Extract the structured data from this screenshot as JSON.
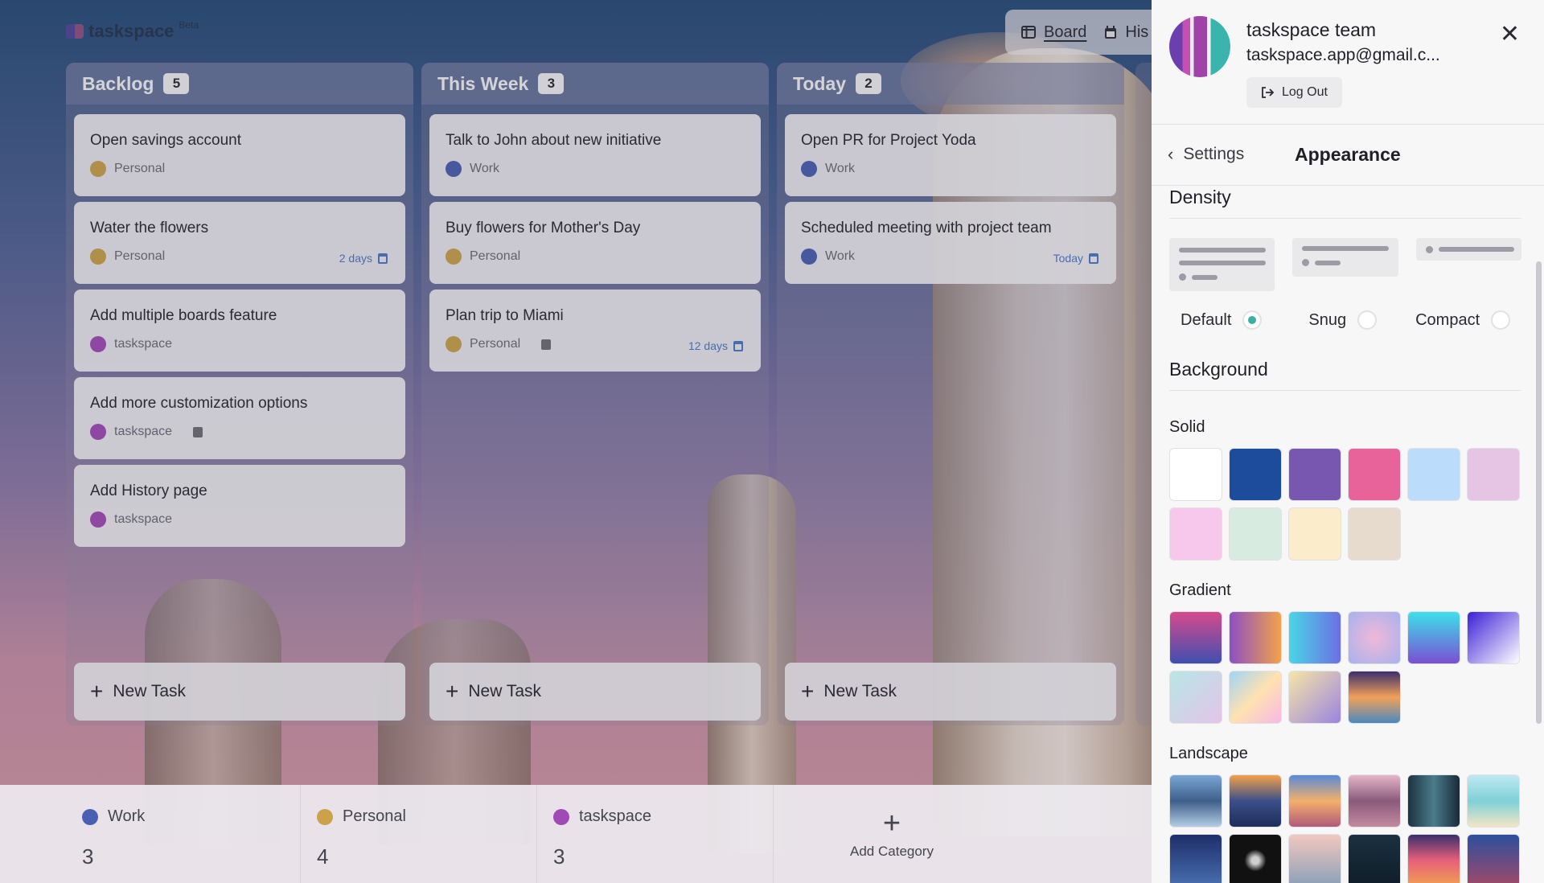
{
  "app": {
    "name": "taskspace",
    "badge": "Beta"
  },
  "view_tabs": [
    {
      "label": "Board",
      "icon": "board-icon",
      "active": true
    },
    {
      "label": "His",
      "icon": "calendar-icon",
      "active": false
    }
  ],
  "columns": [
    {
      "title": "Backlog",
      "count": "5",
      "cards": [
        {
          "title": "Open savings account",
          "category": "Personal",
          "color": "#c9a24a"
        },
        {
          "title": "Water the flowers",
          "category": "Personal",
          "color": "#c9a24a",
          "due": "2 days"
        },
        {
          "title": "Add multiple boards feature",
          "category": "taskspace",
          "color": "#a04ab8"
        },
        {
          "title": "Add more customization options",
          "category": "taskspace",
          "color": "#a04ab8",
          "note": true
        },
        {
          "title": "Add History page",
          "category": "taskspace",
          "color": "#a04ab8"
        }
      ],
      "new_task": "New Task"
    },
    {
      "title": "This Week",
      "count": "3",
      "cards": [
        {
          "title": "Talk to John about new initiative",
          "category": "Work",
          "color": "#4a5eb3"
        },
        {
          "title": "Buy flowers for Mother's Day",
          "category": "Personal",
          "color": "#c9a24a"
        },
        {
          "title": "Plan trip to Miami",
          "category": "Personal",
          "color": "#c9a24a",
          "note": true,
          "due": "12 days"
        }
      ],
      "new_task": "New Task"
    },
    {
      "title": "Today",
      "count": "2",
      "cards": [
        {
          "title": "Open PR for Project Yoda",
          "category": "Work",
          "color": "#4a5eb3"
        },
        {
          "title": "Scheduled meeting with project team",
          "category": "Work",
          "color": "#4a5eb3",
          "due": "Today"
        }
      ],
      "new_task": "New Task"
    }
  ],
  "categories": [
    {
      "name": "Work",
      "count": "3",
      "color": "#4a5eb3"
    },
    {
      "name": "Personal",
      "count": "4",
      "color": "#c9a24a"
    },
    {
      "name": "taskspace",
      "count": "3",
      "color": "#a04ab8"
    }
  ],
  "add_category": "Add Category",
  "account": {
    "name": "taskspace team",
    "email": "taskspace.app@gmail.c...",
    "logout": "Log Out"
  },
  "settings": {
    "back": "Settings",
    "title": "Appearance",
    "density": {
      "heading": "Density",
      "options": [
        {
          "label": "Default",
          "selected": true
        },
        {
          "label": "Snug",
          "selected": false
        },
        {
          "label": "Compact",
          "selected": false
        }
      ]
    },
    "background": {
      "heading": "Background",
      "solid": {
        "label": "Solid",
        "colors": [
          "#ffffff",
          "#1e4c9c",
          "#7857b0",
          "#e8639a",
          "#bcdcfb",
          "#e6c4e4",
          "#f8c8ec",
          "#d7ebe1",
          "#fbeccc",
          "#e7dbce"
        ]
      },
      "gradient": {
        "label": "Gradient",
        "colors": [
          "linear-gradient(180deg,#d74a8c,#3f4fb0)",
          "linear-gradient(90deg,#8d4fc4,#f3a24a)",
          "linear-gradient(90deg,#4ad6e6,#6b6fe4)",
          "radial-gradient(#f1b8d8,#a6b2ee)",
          "linear-gradient(180deg,#3ee0ea,#7a4fd4)",
          "linear-gradient(135deg,#3b1fd6,#ffffff)",
          "linear-gradient(135deg,#b7e6e6,#e4c4e8)",
          "linear-gradient(135deg,#9fd4f6,#ffe2b0,#f7b8e6)",
          "linear-gradient(135deg,#f5e6a6,#9b84e0)",
          "linear-gradient(180deg,#3b2f6a,#f2a05a,#4a8ac0)"
        ]
      },
      "landscape": {
        "label": "Landscape",
        "colors": [
          "linear-gradient(180deg,#7aa6d6,#3f5f8a,#b4cde4)",
          "linear-gradient(180deg,#f3a04a,#3b4f8a,#1d2d5a)",
          "linear-gradient(180deg,#5a8ad6,#f3b06a,#b05a7a)",
          "linear-gradient(180deg,#e4b6c8,#8a5a7a,#c28aa0)",
          "linear-gradient(90deg,#1e3340,#4a7c8c,#1a2a36)",
          "linear-gradient(180deg,#bfe9f2,#7fd0d8,#f3e6c4)",
          "linear-gradient(180deg,#1d2e6a,#4a6fb0)",
          "radial-gradient(#cfcfcf 10%,#111 30%)",
          "linear-gradient(180deg,#f2c8c0,#8aa0b8)",
          "linear-gradient(180deg,#1b3040,#0f1d28)",
          "linear-gradient(180deg,#3a2f6a,#e8607a,#f0a050)",
          "linear-gradient(180deg,#2c4f9c,#a04a6a)"
        ]
      }
    }
  }
}
